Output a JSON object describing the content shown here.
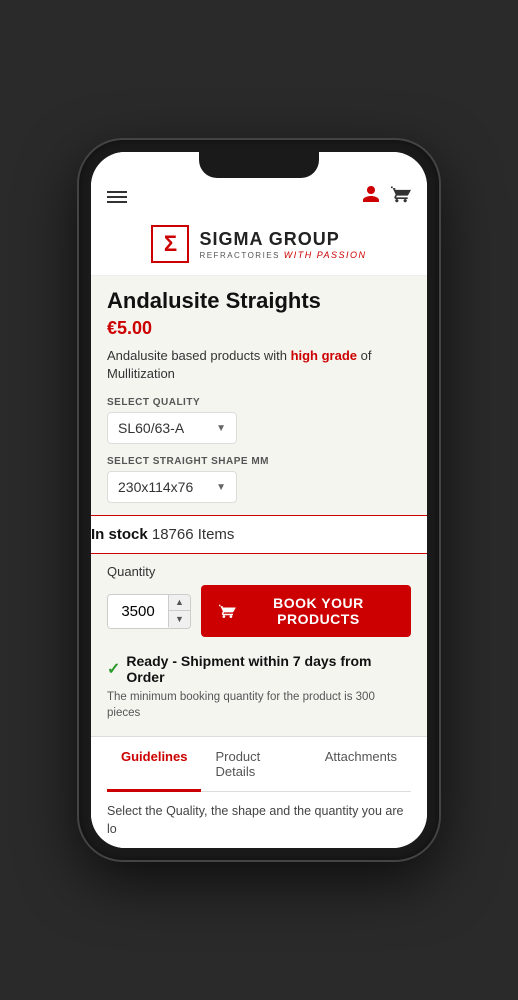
{
  "phone": {
    "header": {
      "menu_icon": "hamburger",
      "user_icon": "person",
      "cart_icon": "cart"
    },
    "logo": {
      "sigma_symbol": "Σ",
      "brand_name": "SIGMA GROUP",
      "sub_label": "REFRACTORIES",
      "passion_text": "with passion"
    },
    "product": {
      "title": "Andalusite Straights",
      "price": "€5.00",
      "description_prefix": "Andalusite based products with ",
      "description_highlight": "high grade",
      "description_suffix": " of Mullitization",
      "select_quality_label": "SELECT QUALITY",
      "quality_value": "SL60/63-A",
      "select_shape_label": "SELECT STRAIGHT SHAPE mm",
      "shape_value": "230x114x76",
      "stock_label": "In stock",
      "stock_count": "18766 Items",
      "quantity_label": "Quantity",
      "quantity_value": "3500",
      "book_button_label": "BOOK YOUR PRODUCTS",
      "shipment_check": "✓",
      "shipment_text": "Ready - Shipment within 7 days from Order",
      "shipment_note": "The minimum booking quantity for the product is 300 pieces"
    },
    "tabs": [
      {
        "id": "guidelines",
        "label": "Guidelines",
        "active": true
      },
      {
        "id": "product-details",
        "label": "Product Details",
        "active": false
      },
      {
        "id": "attachments",
        "label": "Attachments",
        "active": false
      }
    ],
    "tab_content": "Select the Quality, the shape and the quantity you are lo"
  }
}
